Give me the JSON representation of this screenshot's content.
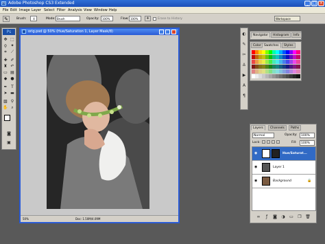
{
  "app": {
    "title": "Adobe Photoshop CS3 Extended"
  },
  "menu": [
    "File",
    "Edit",
    "Image",
    "Layer",
    "Select",
    "Filter",
    "Analysis",
    "View",
    "Window",
    "Help"
  ],
  "options": {
    "brush_label": "Brush:",
    "brush_size": "4",
    "mode_label": "Mode:",
    "mode_value": "Brush",
    "opacity_label": "Opacity:",
    "opacity_value": "100%",
    "flow_label": "Flow:",
    "flow_value": "100%",
    "erase_history": "Erase to History",
    "workspace_label": "Workspace"
  },
  "tools": {
    "ps_logo": "Ps"
  },
  "document": {
    "title": "orig.psd @ 50% (Hue/Saturation 1, Layer Mask/8)",
    "zoom": "50%",
    "doc_size": "Doc: 1.50M/4.09M"
  },
  "panels": {
    "nav_tabs": [
      "Navigator",
      "Histogram",
      "Info"
    ],
    "color_tabs": [
      "Color",
      "Swatches",
      "Styles"
    ],
    "layers_tabs": [
      "Layers",
      "Channels",
      "Paths"
    ],
    "blend_mode": "Normal",
    "opacity_label": "Opacity:",
    "opacity_value": "100%",
    "lock_label": "Lock:",
    "fill_label": "Fill:",
    "fill_value": "100%",
    "layers": [
      {
        "name": "Hue/Saturat...",
        "selected": true
      },
      {
        "name": "Layer 1",
        "selected": false
      },
      {
        "name": "Background",
        "selected": false
      }
    ]
  },
  "colors": {
    "selection": "#316ac5",
    "workspace": "#595959",
    "panel": "#d4d0c8"
  }
}
